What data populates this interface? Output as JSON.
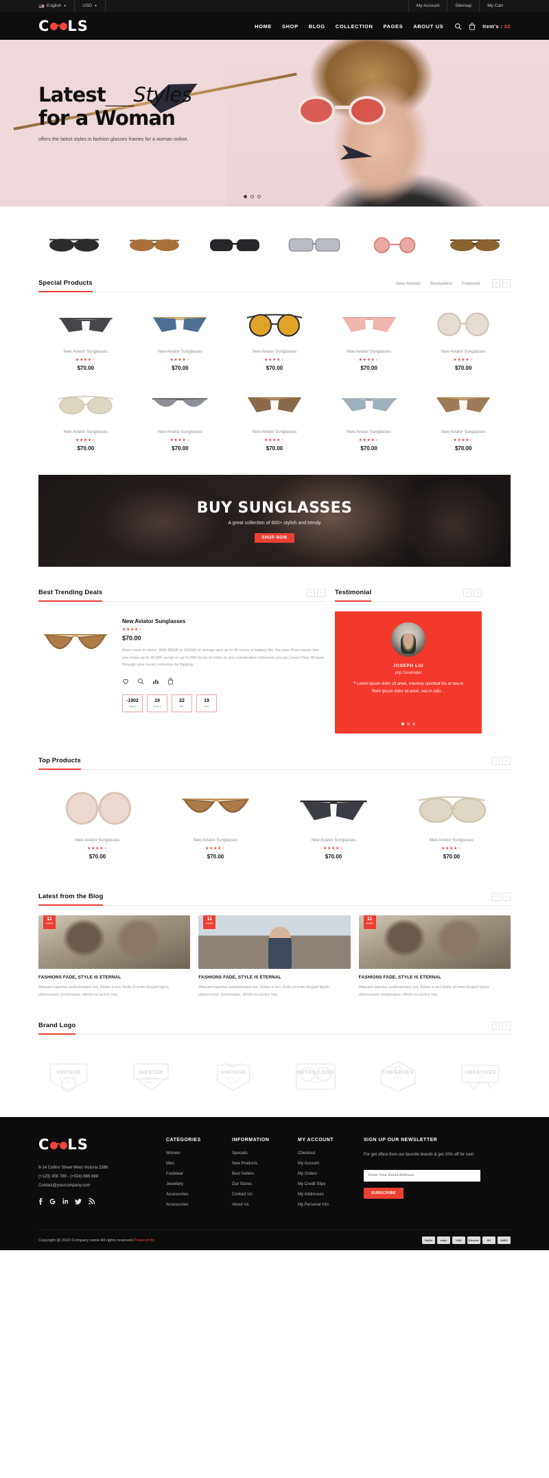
{
  "topbar": {
    "language": "English",
    "currency": "USD",
    "links": [
      "My Account",
      "Sitemap",
      "My Cart"
    ]
  },
  "header": {
    "brand": "COOLS",
    "nav": [
      "HOME",
      "SHOP",
      "BLOG",
      "COLLECTION",
      "PAGES",
      "ABOUT US"
    ],
    "search_icon": "search-icon",
    "cart_icon": "cart-icon",
    "cart_label": "Item's :",
    "cart_count": "02"
  },
  "hero": {
    "title_strong": "Latest",
    "title_dashes": "___",
    "title_italic": "Styles",
    "title_line2": "for a Woman",
    "subtitle": "offers the latest styles in fashion glasses frames for a woman online."
  },
  "special_products": {
    "title": "Special Products",
    "tabs": [
      "New Arrivals",
      "Bestsellers",
      "Featured"
    ],
    "prev": "‹",
    "next": "›",
    "items": [
      {
        "name": "New Aviator Sunglasses",
        "rating": 4,
        "price": "$70.00"
      },
      {
        "name": "New Aviator Sunglasses",
        "rating": 4,
        "price": "$70.00"
      },
      {
        "name": "New Aviator Sunglasses",
        "rating": 4,
        "price": "$70.00"
      },
      {
        "name": "New Aviator Sunglasses",
        "rating": 4,
        "price": "$70.00"
      },
      {
        "name": "New Aviator Sunglasses",
        "rating": 4,
        "price": "$70.00"
      },
      {
        "name": "New Aviator Sunglasses",
        "rating": 4,
        "price": "$70.00"
      },
      {
        "name": "New Aviator Sunglasses",
        "rating": 4,
        "price": "$70.00"
      },
      {
        "name": "New Aviator Sunglasses",
        "rating": 4,
        "price": "$70.00"
      },
      {
        "name": "New Aviator Sunglasses",
        "rating": 4,
        "price": "$70.00"
      },
      {
        "name": "New Aviator Sunglasses",
        "rating": 4,
        "price": "$70.00"
      }
    ]
  },
  "banner": {
    "heading": "BUY SUNGLASSES",
    "sub": "A great collection of 600+ stylish and trendy",
    "button": "SHOP NOW"
  },
  "trending": {
    "title": "Best Trending Deals",
    "prev": "‹",
    "next": "›",
    "product": {
      "name": "New Aviator Sunglasses",
      "rating": 4,
      "price": "$70.00",
      "description": "More room to move. With 80GB or 160GB of storage and up to 40 hours of battery life, the new iPod classic lets you enjoy up to 40,000 songs or up to 200 hours of video or any combination wherever you go.Cover Flow. Browse through your music collection by flipping.."
    },
    "actions": [
      "wishlist-icon",
      "quickview-icon",
      "compare-icon",
      "addtocart-icon"
    ],
    "countdown": [
      {
        "value": "-1902",
        "label": "Days"
      },
      {
        "value": "19",
        "label": "Hours"
      },
      {
        "value": "22",
        "label": "Min"
      },
      {
        "value": "19",
        "label": "Sec"
      }
    ]
  },
  "testimonial": {
    "title": "Testimonial",
    "prev": "‹",
    "next": "›",
    "name": "JOSEPH LUI",
    "role": "php Developer",
    "quote_mark": "❝",
    "text": "Lorem ipsum dolor sit amet, volumus oporteat his at sea in Rem ipsum dolor sit amet, sea in odio ..",
    "dots": 3,
    "active_dot": 0
  },
  "top_products": {
    "title": "Top Products",
    "prev": "‹",
    "next": "›",
    "items": [
      {
        "name": "New Aviator Sunglasses",
        "rating": 4,
        "price": "$70.00"
      },
      {
        "name": "New Aviator Sunglasses",
        "rating": 4,
        "price": "$70.00"
      },
      {
        "name": "New Aviator Sunglasses",
        "rating": 4,
        "price": "$70.00"
      },
      {
        "name": "New Aviator Sunglasses",
        "rating": 4,
        "price": "$70.00"
      }
    ]
  },
  "blog": {
    "title": "Latest from the Blog",
    "prev": "‹",
    "next": "›",
    "posts": [
      {
        "day": "11",
        "month": "AUG",
        "title": "FASHIONS FADE, STYLE IS ETERNAL",
        "excerpt": "Aliquam egestas pellentesque est. Etiam a orci Nulla id enim feugiat ligula ullamcorper scelerisque. Morbi eu luctus nisl."
      },
      {
        "day": "11",
        "month": "AUG",
        "title": "FASHIONS FADE, STYLE IS ETERNAL",
        "excerpt": "Aliquam egestas pellentesque est. Etiam a orci Nulla id enim feugiat ligula ullamcorper scelerisque. Morbi eu luctus nisl."
      },
      {
        "day": "11",
        "month": "AUG",
        "title": "FASHIONS FADE, STYLE IS ETERNAL",
        "excerpt": "Aliquam egestas pellentesque est. Etiam a orci Nulla id enim feugiat ligula ullamcorper scelerisque. Morbi eu luctus nisl."
      }
    ]
  },
  "brand_logo": {
    "title": "Brand Logo",
    "prev": "‹",
    "next": "›",
    "items": [
      {
        "label": "VINTAGE",
        "sub": "ESTABLISHED",
        "sub2": "1989"
      },
      {
        "label": "HIPSTER",
        "sub": "PREMIUM",
        "sub2": "QUALITY"
      },
      {
        "label": "·VINTAGE·",
        "sub": "hipster style",
        "sub2": "EST 1989"
      },
      {
        "label": "RETRO LOGO",
        "sub": "CLASSIC",
        "sub2": "DESIGN"
      },
      {
        "label": "CREATIVES",
        "sub": "· DESIGN ·",
        "sub2": ""
      },
      {
        "label": "CREATIVES",
        "sub": "STUDIO",
        "sub2": "2018"
      }
    ]
  },
  "footer": {
    "brand": "COOLS",
    "address": "8-14 Collins Street West Victoria 2386",
    "phone": "(+123) 456 789 - (+024) 666 888",
    "email": "Contact@yourcompany.com",
    "social": [
      "facebook-icon",
      "google-icon",
      "linkedin-icon",
      "twitter-icon",
      "rss-icon"
    ],
    "columns": [
      {
        "heading": "CATEGORIES",
        "links": [
          "Women",
          "Men",
          "Footwear",
          "Jewellery",
          "Accessories",
          "Accessories"
        ]
      },
      {
        "heading": "INFORMATION",
        "links": [
          "Specials",
          "New Products",
          "Best Sellers",
          "Our Stores",
          "Contact Us",
          "About Us"
        ]
      },
      {
        "heading": "MY ACCOUNT",
        "links": [
          "Checkout",
          "My Account",
          "My Orders",
          "My Credit Slips",
          "My Addresses",
          "My Personal Info"
        ]
      }
    ],
    "newsletter": {
      "heading": "SIGN UP OUR NEWSLETTER",
      "text": "For get offers from our favorite brands & get 20% off for next",
      "placeholder": "Enter Your Email Address",
      "button": "SUBSCRIBE"
    },
    "copyright_pre": "Copyright @ 2022 Company name All rights reserved.",
    "copyright_link": "Powered By",
    "payments": [
      "PayPal",
      "stripe",
      "VISA",
      "Discover",
      "MC",
      "AMEX"
    ]
  },
  "colors": {
    "accent": "#ec4034",
    "dark": "#0c0c0c",
    "hero_bg": "#eed8da"
  }
}
